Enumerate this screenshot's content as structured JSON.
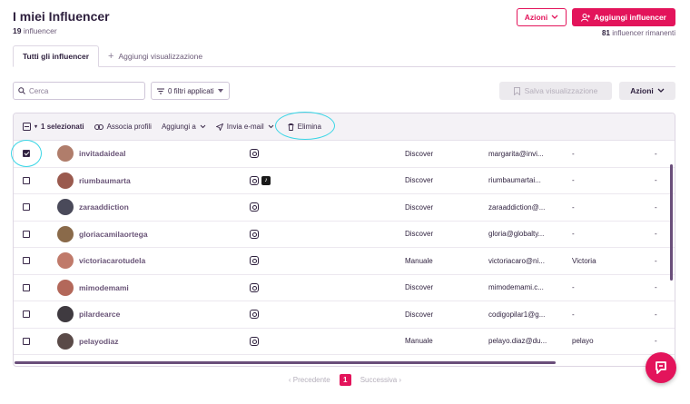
{
  "header": {
    "title": "I miei Influencer",
    "count": "19",
    "count_suffix": "influencer"
  },
  "top_actions": {
    "actions_label": "Azioni",
    "add_label": "Aggiungi influencer",
    "remaining_count": "81",
    "remaining_suffix": "influencer rimanenti"
  },
  "tabs": [
    {
      "label": "Tutti gli influencer"
    },
    {
      "label": "Aggiungi visualizzazione"
    }
  ],
  "toolbar": {
    "search_placeholder": "Cerca",
    "filters_label": "0 filtri applicati",
    "save_view_label": "Salva visualizzazione",
    "actions_label": "Azioni"
  },
  "bulk": {
    "selected": "1 selezionati",
    "associate": "Associa profili",
    "add_to": "Aggiungi a",
    "send_email": "Invia e-mail",
    "delete": "Elimina"
  },
  "rows": [
    {
      "name": "invitadaideal",
      "source": "Discover",
      "email": "margarita@invi...",
      "c5": "-",
      "c6": "-",
      "tiktok": false,
      "checked": true,
      "avatar": "#b07d6b"
    },
    {
      "name": "riumbaumarta",
      "source": "Discover",
      "email": "riumbaumartai...",
      "c5": "-",
      "c6": "-",
      "tiktok": true,
      "checked": false,
      "avatar": "#9a5a4e"
    },
    {
      "name": "zaraaddiction",
      "source": "Discover",
      "email": "zaraaddiction@...",
      "c5": "-",
      "c6": "-",
      "tiktok": false,
      "checked": false,
      "avatar": "#4a4a5a"
    },
    {
      "name": "gloriacamilaortega",
      "source": "Discover",
      "email": "gloria@globalty...",
      "c5": "-",
      "c6": "-",
      "tiktok": false,
      "checked": false,
      "avatar": "#8a6a4a"
    },
    {
      "name": "victoriacarotudela",
      "source": "Manuale",
      "email": "victoriacaro@ni...",
      "c5": "Victoria",
      "c6": "-",
      "tiktok": false,
      "checked": false,
      "avatar": "#c07a6a"
    },
    {
      "name": "mimodemami",
      "source": "Discover",
      "email": "mimodemami.c...",
      "c5": "-",
      "c6": "-",
      "tiktok": false,
      "checked": false,
      "avatar": "#b3685a"
    },
    {
      "name": "pilardearce",
      "source": "Discover",
      "email": "codigopilar1@g...",
      "c5": "-",
      "c6": "-",
      "tiktok": false,
      "checked": false,
      "avatar": "#3f3a40"
    },
    {
      "name": "pelayodiaz",
      "source": "Manuale",
      "email": "pelayo.diaz@du...",
      "c5": "pelayo",
      "c6": "-",
      "tiktok": false,
      "checked": false,
      "avatar": "#5a4a48"
    }
  ],
  "pager": {
    "prev": "Precedente",
    "page": "1",
    "next": "Successiva"
  },
  "colors": {
    "accent": "#e3145b",
    "highlight": "#3ad6e6"
  }
}
